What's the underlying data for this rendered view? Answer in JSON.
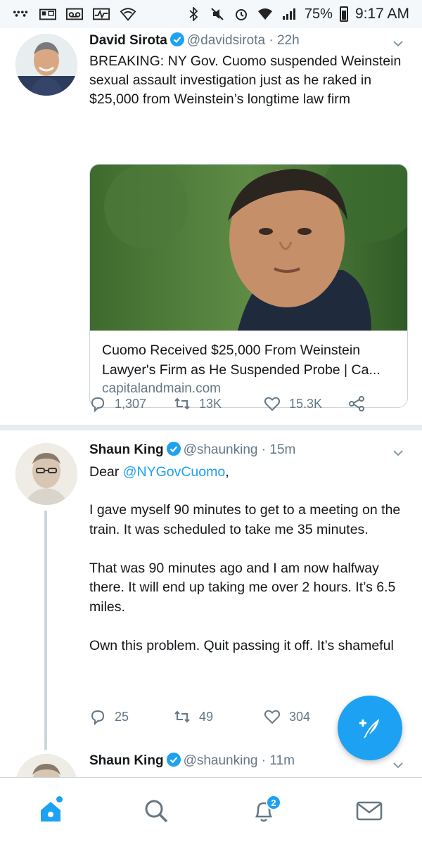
{
  "status_bar": {
    "battery": "75%",
    "time": "9:17 AM"
  },
  "tweets": [
    {
      "name": "David Sirota",
      "handle": "@davidsirota",
      "time": "22h",
      "text": "BREAKING: NY Gov. Cuomo suspended Weinstein sexual assault investigation just as he raked in $25,000 from Weinstein’s longtime law firm",
      "card": {
        "title": "Cuomo Received $25,000 From Weinstein Lawyer's Firm as He Suspended Probe | Ca...",
        "domain": "capitalandmain.com"
      },
      "replies": "1,307",
      "retweets": "13K",
      "likes": "15.3K"
    },
    {
      "name": "Shaun King",
      "handle": "@shaunking",
      "time": "15m",
      "greeting_prefix": "Dear ",
      "mention": "@NYGovCuomo",
      "greeting_suffix": ",",
      "text": "I gave myself 90 minutes to get to a meeting on the train. It was scheduled to take me 35 minutes.\n\nThat was 90 minutes ago and I am now halfway there. It will end up taking me over 2 hours. It’s 6.5 miles.\n\nOwn this problem. Quit passing it off. It’s shameful",
      "replies": "25",
      "retweets": "49",
      "likes": "304"
    },
    {
      "name": "Shaun King",
      "handle": "@shaunking",
      "time": "11m"
    }
  ],
  "separator": " · ",
  "bottom_nav": {
    "notifications_badge": "2"
  },
  "colors": {
    "accent": "#1da1f2",
    "secondary_text": "#657786",
    "divider": "#e6ecf0"
  },
  "icons": [
    "home-icon",
    "search-icon",
    "notifications-bell-icon",
    "messages-envelope-icon",
    "compose-tweet-icon",
    "reply-icon",
    "retweet-icon",
    "like-heart-icon",
    "share-icon",
    "verified-badge-icon",
    "chevron-down-icon"
  ]
}
